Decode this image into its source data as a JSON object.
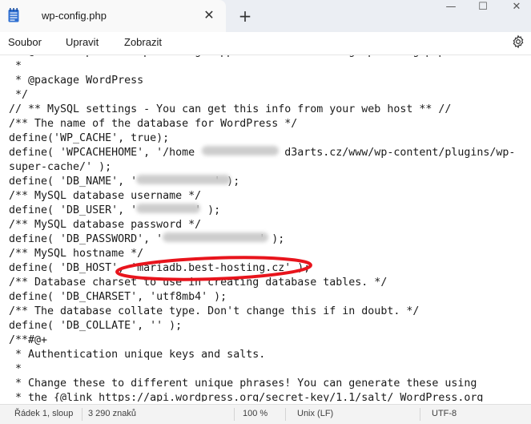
{
  "tab": {
    "title": "wp-config.php",
    "close_glyph": "✕",
    "new_tab_glyph": "+"
  },
  "window_controls": {
    "minimize": "—",
    "maximize": "☐",
    "close": "✕"
  },
  "menu": {
    "file": "Soubor",
    "edit": "Upravit",
    "view": "Zobrazit"
  },
  "editor": {
    "lines": [
      " * @link https://wordpress.org/support/article/editing-wp-config-php/",
      " *",
      " * @package WordPress",
      " */",
      "// ** MySQL settings - You can get this info from your web host ** //",
      "/** The name of the database for WordPress */",
      "define('WP_CACHE', true);",
      "define( 'WPCACHEHOME', '/home              d3arts.cz/www/wp-content/plugins/wp-",
      "super-cache/' );",
      "define( 'DB_NAME', '            ' );",
      "/** MySQL database username */",
      "define( 'DB_USER', '         ' );",
      "/** MySQL database password */",
      "define( 'DB_PASSWORD', '               ' );",
      "/** MySQL hostname */",
      "define( 'DB_HOST', 'mariadb.best-hosting.cz' );",
      "/** Database charset to use in creating database tables. */",
      "define( 'DB_CHARSET', 'utf8mb4' );",
      "/** The database collate type. Don't change this if in doubt. */",
      "define( 'DB_COLLATE', '' );",
      "/**#@+",
      " * Authentication unique keys and salts.",
      " *",
      " * Change these to different unique phrases! You can generate these using",
      " * the {@link https://api.wordpress.org/secret-key/1.1/salt/ WordPress.org"
    ]
  },
  "status": {
    "position": "Řádek 1, sloup",
    "char_count": "3 290 znaků",
    "zoom": "100 %",
    "line_ending": "Unix (LF)",
    "encoding": "UTF-8"
  },
  "colors": {
    "annotation": "#e8141c",
    "titlebar": "#ebeef3",
    "tab": "#f9f9f9"
  }
}
